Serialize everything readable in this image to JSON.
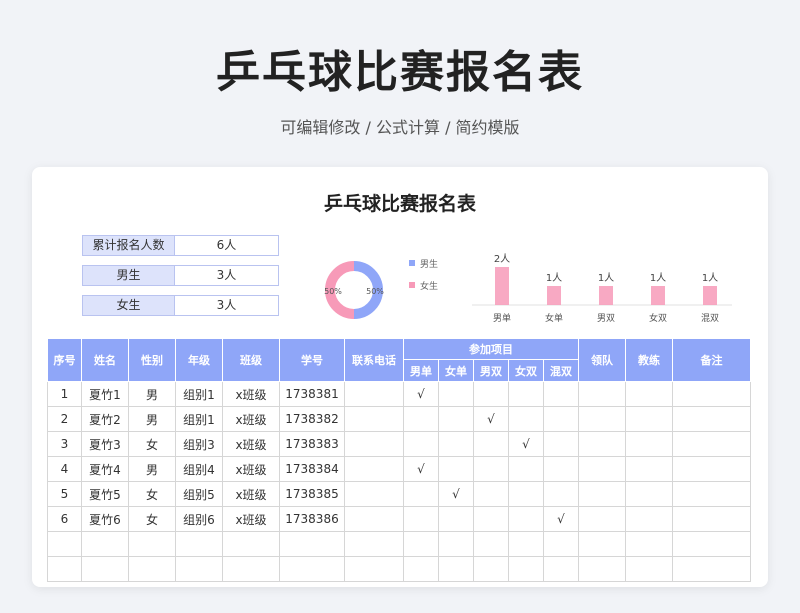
{
  "header": {
    "title": "乒乓球比赛报名表",
    "subtitle": "可编辑修改 /  公式计算  /  简约模版"
  },
  "sheet": {
    "title": "乒乓球比赛报名表",
    "summary": [
      {
        "label": "累计报名人数",
        "value": "6人"
      },
      {
        "label": "男生",
        "value": "3人"
      },
      {
        "label": "女生",
        "value": "3人"
      }
    ]
  },
  "chart_data": [
    {
      "type": "pie",
      "donut": true,
      "labels": [
        "男生",
        "女生"
      ],
      "values": [
        50,
        50
      ],
      "data_labels": [
        "50%",
        "50%"
      ],
      "colors": [
        "#8fa6f8",
        "#f79ab8"
      ],
      "legend": "right"
    },
    {
      "type": "bar",
      "categories": [
        "男单",
        "女单",
        "男双",
        "女双",
        "混双"
      ],
      "values": [
        2,
        1,
        1,
        1,
        1
      ],
      "data_labels": [
        "2人",
        "1人",
        "1人",
        "1人",
        "1人"
      ],
      "color": "#f79ab8",
      "ylim": [
        0,
        2
      ]
    }
  ],
  "table": {
    "headers": {
      "seq": "序号",
      "name": "姓名",
      "gender": "性别",
      "grade": "年级",
      "class": "班级",
      "student_id": "学号",
      "phone": "联系电话",
      "events_group": "参加项目",
      "events": [
        "男单",
        "女单",
        "男双",
        "女双",
        "混双"
      ],
      "leader": "领队",
      "coach": "教练",
      "note": "备注"
    },
    "check_mark": "√",
    "rows": [
      {
        "seq": "1",
        "name": "夏竹1",
        "gender": "男",
        "grade": "组别1",
        "class": "x班级",
        "student_id": "1738381",
        "event_index": 0
      },
      {
        "seq": "2",
        "name": "夏竹2",
        "gender": "男",
        "grade": "组别1",
        "class": "x班级",
        "student_id": "1738382",
        "event_index": 2
      },
      {
        "seq": "3",
        "name": "夏竹3",
        "gender": "女",
        "grade": "组别3",
        "class": "x班级",
        "student_id": "1738383",
        "event_index": 3
      },
      {
        "seq": "4",
        "name": "夏竹4",
        "gender": "男",
        "grade": "组别4",
        "class": "x班级",
        "student_id": "1738384",
        "event_index": 0
      },
      {
        "seq": "5",
        "name": "夏竹5",
        "gender": "女",
        "grade": "组别5",
        "class": "x班级",
        "student_id": "1738385",
        "event_index": 1
      },
      {
        "seq": "6",
        "name": "夏竹6",
        "gender": "女",
        "grade": "组别6",
        "class": "x班级",
        "student_id": "1738386",
        "event_index": 4
      }
    ],
    "empty_rows": 2
  }
}
